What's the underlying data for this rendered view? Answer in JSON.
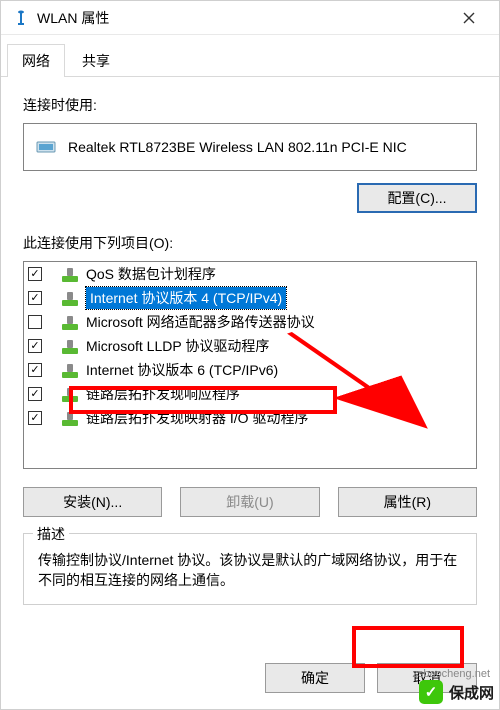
{
  "titlebar": {
    "title": "WLAN 属性"
  },
  "tabs": [
    {
      "label": "网络",
      "active": true
    },
    {
      "label": "共享",
      "active": false
    }
  ],
  "connect_using": {
    "label": "连接时使用:",
    "adapter": "Realtek RTL8723BE Wireless LAN 802.11n PCI-E NIC",
    "configure_button": "配置(C)..."
  },
  "items_section": {
    "label": "此连接使用下列项目(O):",
    "items": [
      {
        "checked": true,
        "icon": "net-component-icon",
        "label": "QoS 数据包计划程序"
      },
      {
        "checked": true,
        "icon": "net-component-icon",
        "label": "Internet 协议版本 4 (TCP/IPv4)",
        "selected": true
      },
      {
        "checked": false,
        "icon": "net-component-icon",
        "label": "Microsoft 网络适配器多路传送器协议"
      },
      {
        "checked": true,
        "icon": "net-component-icon",
        "label": "Microsoft LLDP 协议驱动程序"
      },
      {
        "checked": true,
        "icon": "net-component-icon",
        "label": "Internet 协议版本 6 (TCP/IPv6)"
      },
      {
        "checked": true,
        "icon": "net-component-icon",
        "label": "链路层拓扑发现响应程序"
      },
      {
        "checked": true,
        "icon": "net-component-icon",
        "label": "链路层拓扑发现映射器 I/O 驱动程序"
      }
    ]
  },
  "buttons": {
    "install": "安装(N)...",
    "uninstall": "卸载(U)",
    "properties": "属性(R)"
  },
  "description": {
    "legend": "描述",
    "text": "传输控制协议/Internet 协议。该协议是默认的广域网络协议，用于在不同的相互连接的网络上通信。"
  },
  "footer": {
    "ok": "确定",
    "cancel": "取消"
  },
  "watermark": {
    "site": "zsbaocheng.net",
    "brand": "保成网"
  }
}
